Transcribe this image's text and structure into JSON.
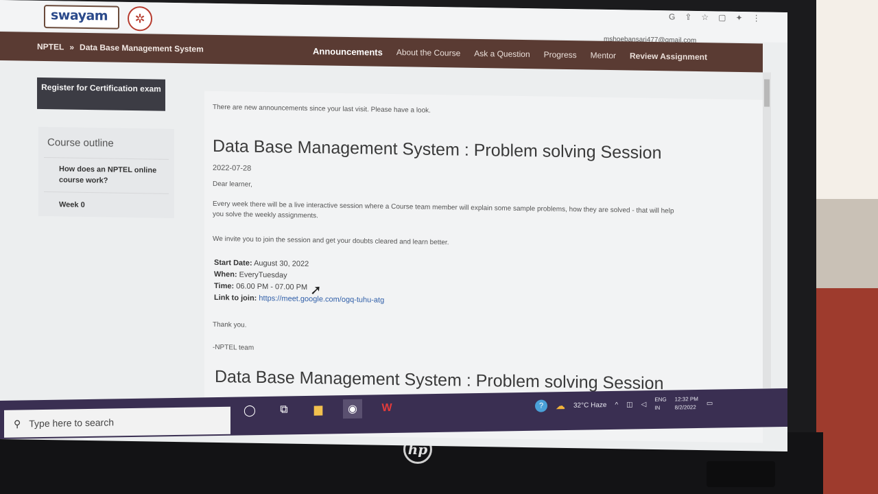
{
  "browser": {
    "icons": [
      "google-icon",
      "share-icon",
      "star-icon",
      "window-icon",
      "extension-icon",
      "menu-icon"
    ],
    "user_email": "mshoebansari477@gmail.com"
  },
  "header": {
    "logo_text": "swayam",
    "breadcrumb_root": "NPTEL",
    "breadcrumb_sep": "»",
    "breadcrumb_course": "Data Base Management System"
  },
  "nav": {
    "items": [
      {
        "label": "Announcements"
      },
      {
        "label": "About the Course"
      },
      {
        "label": "Ask a Question"
      },
      {
        "label": "Progress"
      },
      {
        "label": "Mentor"
      },
      {
        "label": "Review Assignment"
      }
    ]
  },
  "sidebar": {
    "register_label": "Register for Certification exam",
    "outline_title": "Course outline",
    "items": [
      {
        "label": "How does an NPTEL online course work?"
      },
      {
        "label": "Week 0"
      }
    ]
  },
  "announcement": {
    "notice": "There are new announcements since your last visit. Please have a look.",
    "title": "Data Base Management System : Problem solving Session",
    "date": "2022-07-28",
    "greeting": "Dear learner,",
    "para1": "Every week there will be a live interactive session where a Course team member will explain some sample problems, how they are solved - that will help you solve the weekly assignments.",
    "para2": "We invite you to join the session and get your doubts cleared and learn better.",
    "start_label": "Start Date:",
    "start_value": "August 30, 2022",
    "when_label": "When:",
    "when_value": "EveryTuesday",
    "time_label": "Time:",
    "time_value": "06.00 PM - 07.00 PM",
    "link_label": "Link to join:",
    "link_value": "https://meet.google.com/ogq-tuhu-atg",
    "thanks": "Thank you.",
    "sign": "-NPTEL team",
    "next_title": "Data Base Management System : Problem solving Session"
  },
  "taskbar": {
    "search_placeholder": "Type here to search",
    "weather": "32°C  Haze",
    "lang1": "ENG",
    "lang2": "IN",
    "time": "12:32 PM",
    "date": "8/2/2022"
  },
  "device": {
    "brand": "hp"
  }
}
